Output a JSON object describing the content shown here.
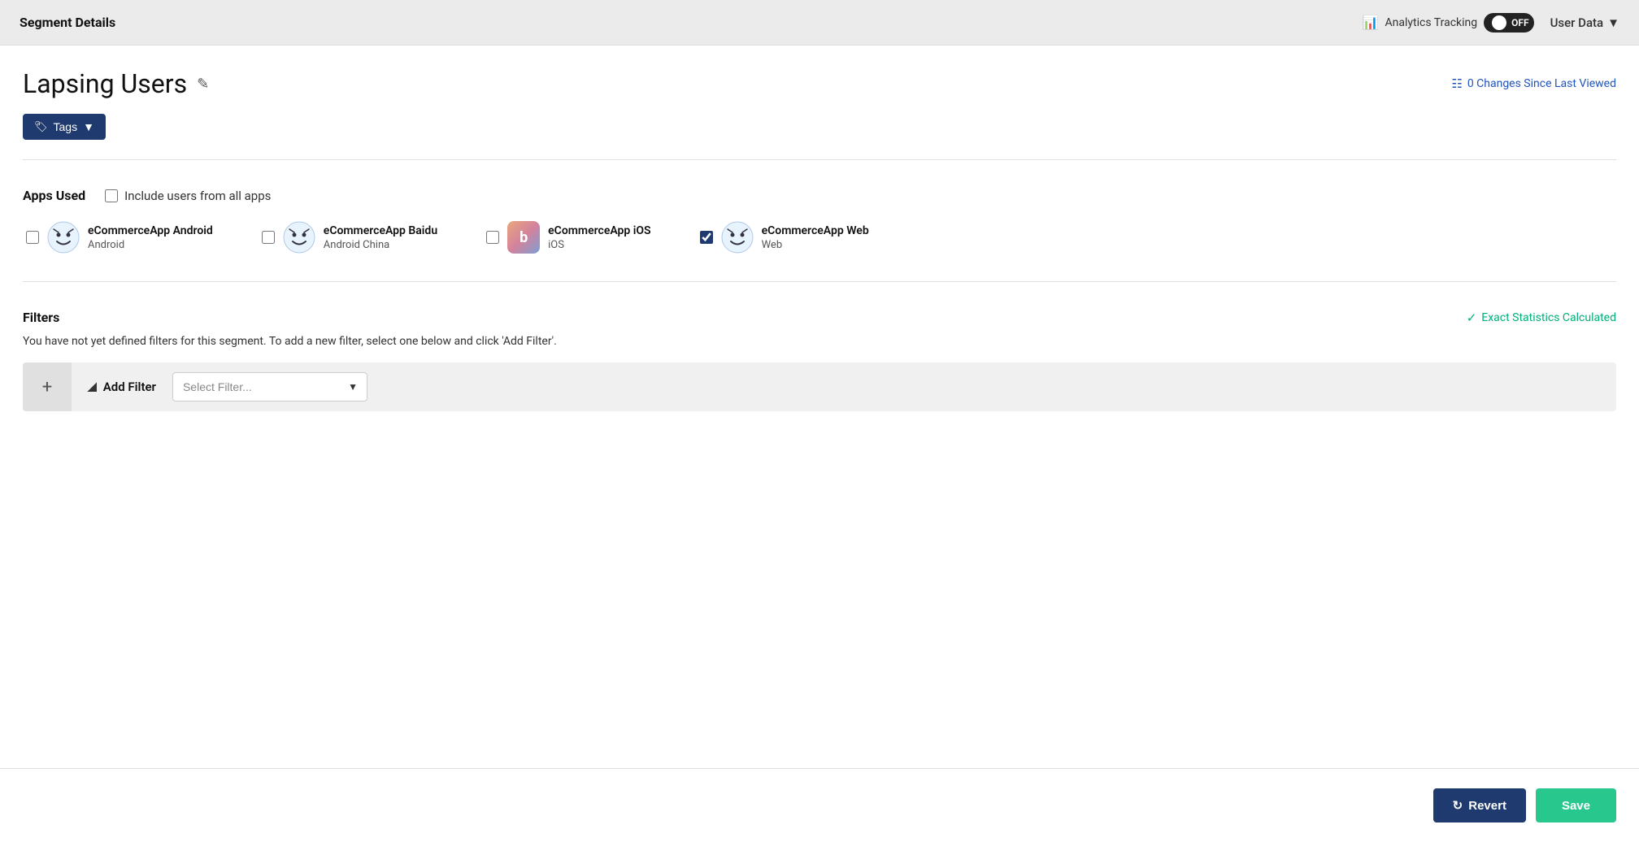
{
  "topbar": {
    "title": "Segment Details",
    "analytics_label": "Analytics Tracking",
    "toggle_state": "OFF",
    "user_data_label": "User Data"
  },
  "page": {
    "title": "Lapsing Users",
    "changes_label": "0 Changes Since Last Viewed",
    "tags_label": "Tags"
  },
  "apps_section": {
    "label": "Apps Used",
    "include_all_label": "Include users from all apps",
    "apps": [
      {
        "name": "eCommerceApp Android",
        "platform": "Android",
        "logo_type": "smiley",
        "checked": false
      },
      {
        "name": "eCommerceApp Baidu",
        "platform": "Android China",
        "logo_type": "smiley",
        "checked": false
      },
      {
        "name": "eCommerceApp iOS",
        "platform": "iOS",
        "logo_type": "ios",
        "checked": false
      },
      {
        "name": "eCommerceApp Web",
        "platform": "Web",
        "logo_type": "smiley",
        "checked": true
      }
    ]
  },
  "filters_section": {
    "label": "Filters",
    "exact_stats_label": "Exact Statistics Calculated",
    "description": "You have not yet defined filters for this segment. To add a new filter, select one below and click 'Add Filter'.",
    "add_filter_label": "Add Filter",
    "select_placeholder": "Select Filter..."
  },
  "actions": {
    "revert_label": "Revert",
    "save_label": "Save"
  }
}
